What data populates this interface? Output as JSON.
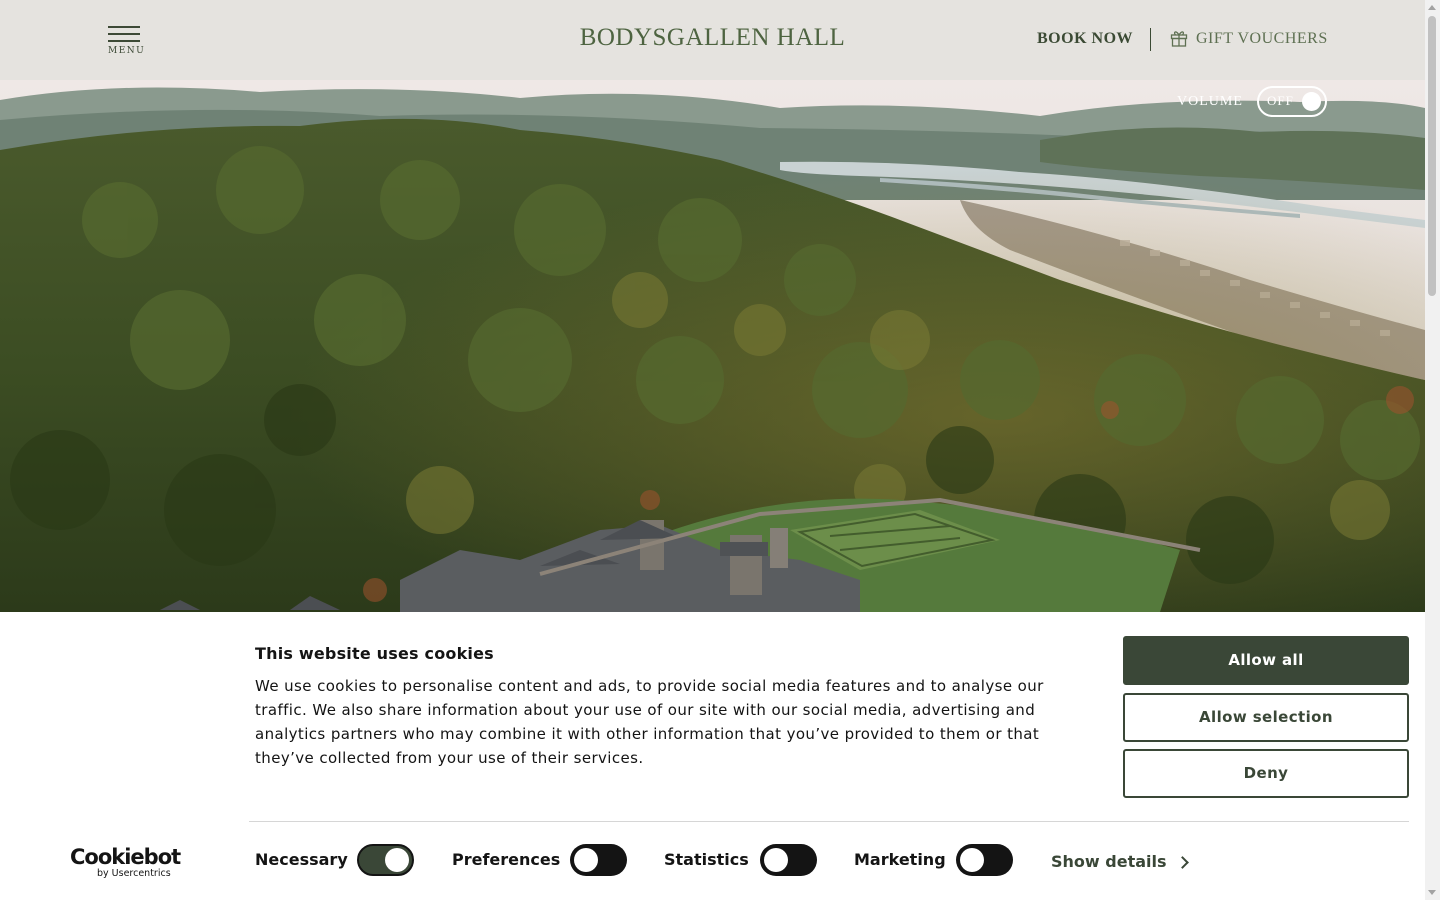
{
  "header": {
    "menu_label": "MENU",
    "brand": "BODYSGALLEN HALL",
    "book_now": "BOOK NOW",
    "gift_vouchers": "GIFT VOUCHERS",
    "gift_icon": "gift-icon",
    "menu_icon": "hamburger-icon"
  },
  "hero": {
    "volume_label": "VOLUME",
    "volume_state": "OFF",
    "image_alt": "Aerial view of wooded hills, estuary and hall with walled gardens"
  },
  "cookie_banner": {
    "title": "This website uses cookies",
    "body": "We use cookies to personalise content and ads, to provide social media features and to analyse our traffic. We also share information about your use of our site with our social media, advertising and analytics partners who may combine it with other information that you’ve provided to them or that they’ve collected from your use of their services.",
    "buttons": {
      "allow_all": "Allow all",
      "allow_selection": "Allow selection",
      "deny": "Deny"
    },
    "logo": {
      "name": "Cookiebot",
      "sub": "by Usercentrics"
    },
    "consents": [
      {
        "label": "Necessary",
        "enabled": true
      },
      {
        "label": "Preferences",
        "enabled": false
      },
      {
        "label": "Statistics",
        "enabled": false
      },
      {
        "label": "Marketing",
        "enabled": false
      }
    ],
    "show_details": "Show details"
  },
  "colors": {
    "header_bg": "#e5e3df",
    "brand_green": "#4e6441",
    "dark_green": "#3a4737",
    "toggle_off": "#141414"
  }
}
